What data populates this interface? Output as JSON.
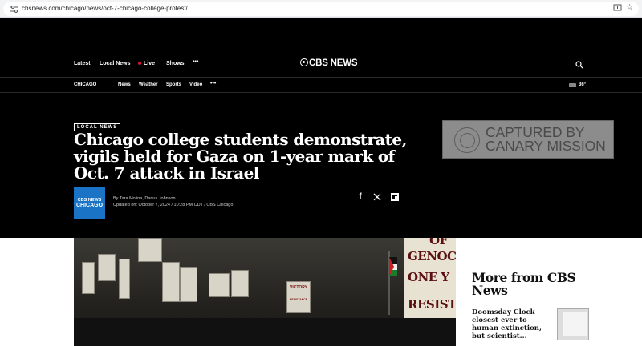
{
  "browser": {
    "url": "cbsnews.com/chicago/news/oct-7-chicago-college-protest/"
  },
  "nav": {
    "items": [
      "Latest",
      "Local News",
      "Live",
      "Shows"
    ],
    "more": "•••",
    "logo": "CBS NEWS"
  },
  "subnav": {
    "location": "CHICAGO",
    "items": [
      "News",
      "Weather",
      "Sports",
      "Video"
    ],
    "more": "•••",
    "temperature": "36°"
  },
  "article": {
    "section": "LOCAL NEWS",
    "headline": "Chicago college students demonstrate, vigils held for Gaza on 1-year mark of Oct. 7 attack in Israel",
    "byline": "By Tara Molina, Darius Johnson",
    "updated": "Updated on: October 7, 2024 / 10:28 PM CDT / CBS Chicago",
    "author_logo": [
      "CBS NEWS",
      "CHICAGO"
    ]
  },
  "ad": {
    "text": [
      "CAPTURED BY",
      "CANARY MISSION"
    ]
  },
  "photo": {
    "signs": [
      "OF",
      "GENOC",
      "ONE Y",
      "RESISTA",
      "VICTORY",
      "RESISTANCE"
    ]
  },
  "sidebar": {
    "title": "More from CBS News",
    "story": "Doomsday Clock closest ever to human extinction, but scientist..."
  }
}
